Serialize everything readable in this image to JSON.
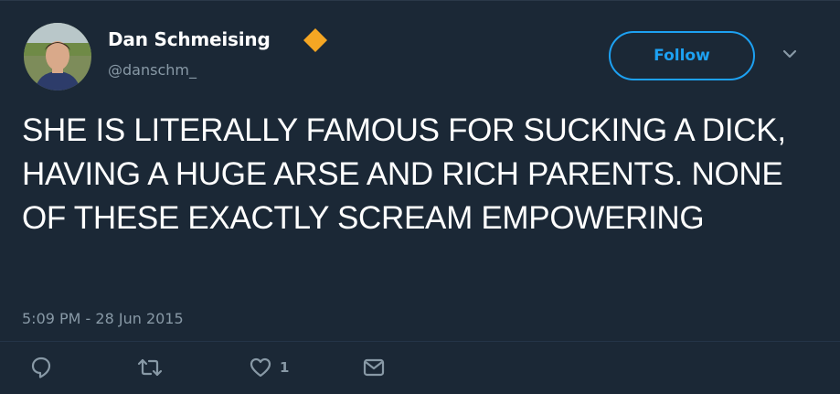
{
  "user": {
    "display_name": "Dan Schmeising",
    "handle": "@danschm_",
    "avatar_icon": "profile-photo",
    "badge_icon": "orange-diamond-icon"
  },
  "header": {
    "follow_label": "Follow"
  },
  "tweet": {
    "text": "SHE IS LITERALLY FAMOUS FOR SUCKING A DICK, HAVING A HUGE ARSE AND RICH PARENTS. NONE OF THESE EXACTLY SCREAM EMPOWERING",
    "timestamp": "5:09 PM - 28 Jun 2015"
  },
  "actions": {
    "reply_icon": "reply-icon",
    "retweet_icon": "retweet-icon",
    "like_icon": "heart-icon",
    "like_count": "1",
    "dm_icon": "envelope-icon"
  },
  "colors": {
    "background": "#1b2836",
    "accent": "#1da1f2",
    "muted": "#8899a6",
    "badge": "#f5a623"
  }
}
